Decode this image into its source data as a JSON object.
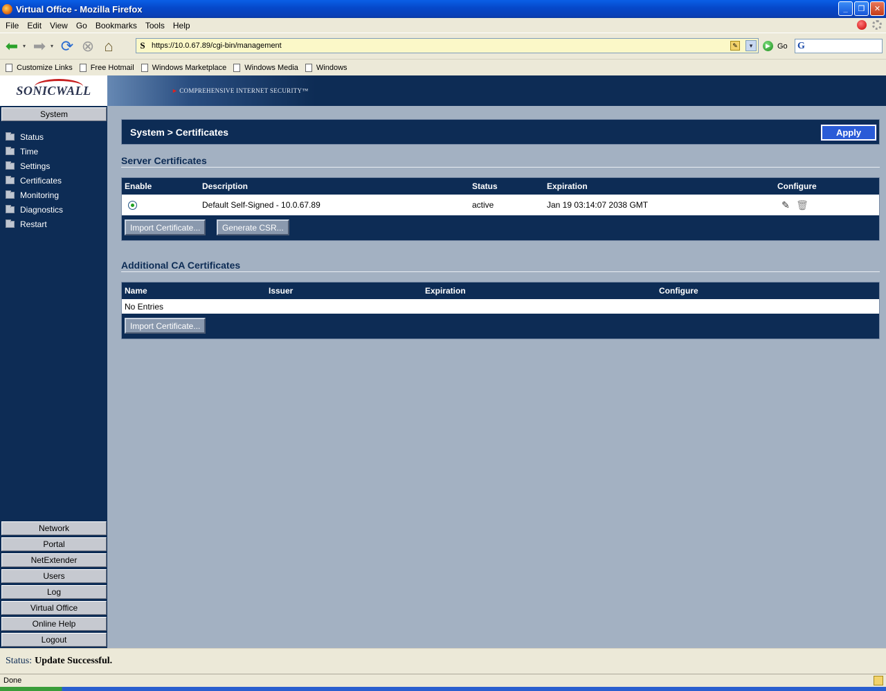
{
  "window": {
    "title": "Virtual Office - Mozilla Firefox"
  },
  "menu": [
    "File",
    "Edit",
    "View",
    "Go",
    "Bookmarks",
    "Tools",
    "Help"
  ],
  "navbar": {
    "url": "https://10.0.67.89/cgi-bin/management",
    "go_label": "Go"
  },
  "bookmarks": [
    "Customize Links",
    "Free Hotmail",
    "Windows Marketplace",
    "Windows Media",
    "Windows"
  ],
  "banner": {
    "logo": "SONICWALL",
    "tagline": "COMPREHENSIVE INTERNET SECURITY™"
  },
  "sidebar": {
    "top_button": "System",
    "items": [
      "Status",
      "Time",
      "Settings",
      "Certificates",
      "Monitoring",
      "Diagnostics",
      "Restart"
    ],
    "bottom_buttons": [
      "Network",
      "Portal",
      "NetExtender",
      "Users",
      "Log",
      "Virtual Office",
      "Online Help",
      "Logout"
    ]
  },
  "content": {
    "breadcrumb": "System > Certificates",
    "apply_label": "Apply",
    "server": {
      "title": "Server Certificates",
      "headers": [
        "Enable",
        "Description",
        "Status",
        "Expiration",
        "Configure"
      ],
      "row": {
        "description": "Default Self-Signed - 10.0.67.89",
        "status": "active",
        "expiration": "Jan 19 03:14:07 2038 GMT"
      },
      "import_label": "Import Certificate...",
      "csr_label": "Generate CSR..."
    },
    "ca": {
      "title": "Additional CA Certificates",
      "headers": [
        "Name",
        "Issuer",
        "Expiration",
        "Configure"
      ],
      "empty": "No Entries",
      "import_label": "Import Certificate..."
    }
  },
  "status": {
    "label": "Status:",
    "message": "Update Successful."
  },
  "browser_status": "Done"
}
